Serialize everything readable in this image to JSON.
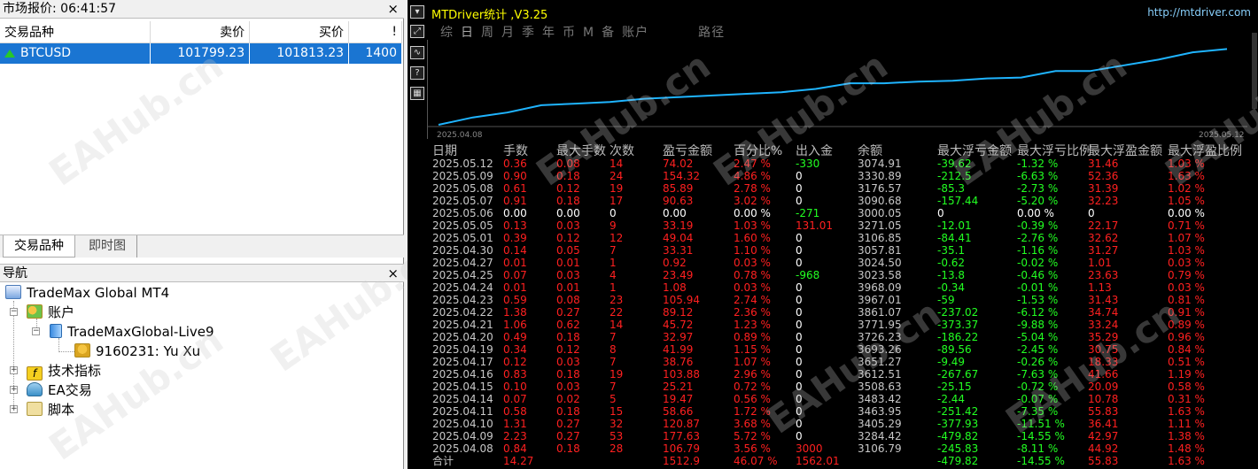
{
  "market_watch": {
    "title": "市场报价: 06:41:57",
    "close_label": "×",
    "columns": [
      "交易品种",
      "卖价",
      "买价",
      "!"
    ],
    "rows": [
      {
        "symbol": "BTCUSD",
        "bid": "101799.23",
        "ask": "101813.23",
        "spread": "1400"
      }
    ],
    "tabs": [
      "交易品种",
      "即时图"
    ]
  },
  "navigator": {
    "title": "导航",
    "close_label": "×",
    "root": "TradeMax Global MT4",
    "accounts": "账户",
    "server": "TradeMaxGlobal-Live9",
    "account": "9160231: Yu Xu",
    "indicators": "技术指标",
    "experts": "EA交易",
    "scripts": "脚本"
  },
  "chart": {
    "indicator_title": "MTDriver统计 ,V3.25",
    "url": "http://mtdriver.com",
    "menu": [
      "综",
      "日",
      "周",
      "月",
      "季",
      "年",
      "币",
      "M",
      "备",
      "账户",
      "",
      "路径"
    ],
    "menu_selected_index": 1,
    "equity_curve": {
      "x_start_label": "2025.04.08",
      "x_end_label": "2025.05.12",
      "values": [
        3106.79,
        3284.42,
        3405.29,
        3463.95,
        3483.42,
        3508.63,
        3612.51,
        3651.27,
        3693.26,
        3726.23,
        3771.95,
        3861.07,
        3967.01,
        3968.09,
        3023.58,
        3024.5,
        3057.81,
        3106.85,
        3271.05,
        3000.05,
        3090.68,
        3176.57,
        3330.89,
        3074.91
      ],
      "display_values": [
        0.0,
        0.09,
        0.15,
        0.24,
        0.26,
        0.28,
        0.32,
        0.34,
        0.36,
        0.38,
        0.4,
        0.44,
        0.51,
        0.51,
        0.53,
        0.54,
        0.57,
        0.58,
        0.66,
        0.66,
        0.73,
        0.8,
        0.89,
        0.93
      ],
      "color": "#1fb4ff"
    },
    "headers": [
      "日期",
      "手数",
      "最大手数",
      "次数",
      "盈亏金额",
      "百分比%",
      "出入金",
      "余额",
      "最大浮亏金额",
      "最大浮亏比例",
      "最大浮盈金额",
      "最大浮盈比例"
    ],
    "rows": [
      [
        "2025.05.12",
        "0.36",
        "0.08",
        "14",
        "74.02",
        "2.47 %",
        "-330",
        "3074.91",
        "-39.62",
        "-1.32 %",
        "31.46",
        "1.03 %"
      ],
      [
        "2025.05.09",
        "0.90",
        "0.18",
        "24",
        "154.32",
        "4.86 %",
        "0",
        "3330.89",
        "-212.5",
        "-6.63 %",
        "52.36",
        "1.63 %"
      ],
      [
        "2025.05.08",
        "0.61",
        "0.12",
        "19",
        "85.89",
        "2.78 %",
        "0",
        "3176.57",
        "-85.3",
        "-2.73 %",
        "31.39",
        "1.02 %"
      ],
      [
        "2025.05.07",
        "0.91",
        "0.18",
        "17",
        "90.63",
        "3.02 %",
        "0",
        "3090.68",
        "-157.44",
        "-5.20 %",
        "32.23",
        "1.05 %"
      ],
      [
        "2025.05.06",
        "0.00",
        "0.00",
        "0",
        "0.00",
        "0.00 %",
        "-271",
        "3000.05",
        "0",
        "0.00 %",
        "0",
        "0.00 %"
      ],
      [
        "2025.05.05",
        "0.13",
        "0.03",
        "9",
        "33.19",
        "1.03 %",
        "131.01",
        "3271.05",
        "-12.01",
        "-0.39 %",
        "22.17",
        "0.71 %"
      ],
      [
        "2025.05.01",
        "0.39",
        "0.12",
        "12",
        "49.04",
        "1.60 %",
        "0",
        "3106.85",
        "-84.41",
        "-2.76 %",
        "32.62",
        "1.07 %"
      ],
      [
        "2025.04.30",
        "0.14",
        "0.05",
        "7",
        "33.31",
        "1.10 %",
        "0",
        "3057.81",
        "-35.1",
        "-1.16 %",
        "31.27",
        "1.03 %"
      ],
      [
        "2025.04.27",
        "0.01",
        "0.01",
        "1",
        "0.92",
        "0.03 %",
        "0",
        "3024.50",
        "-0.62",
        "-0.02 %",
        "1.01",
        "0.03 %"
      ],
      [
        "2025.04.25",
        "0.07",
        "0.03",
        "4",
        "23.49",
        "0.78 %",
        "-968",
        "3023.58",
        "-13.8",
        "-0.46 %",
        "23.63",
        "0.79 %"
      ],
      [
        "2025.04.24",
        "0.01",
        "0.01",
        "1",
        "1.08",
        "0.03 %",
        "0",
        "3968.09",
        "-0.34",
        "-0.01 %",
        "1.13",
        "0.03 %"
      ],
      [
        "2025.04.23",
        "0.59",
        "0.08",
        "23",
        "105.94",
        "2.74 %",
        "0",
        "3967.01",
        "-59",
        "-1.53 %",
        "31.43",
        "0.81 %"
      ],
      [
        "2025.04.22",
        "1.38",
        "0.27",
        "22",
        "89.12",
        "2.36 %",
        "0",
        "3861.07",
        "-237.02",
        "-6.12 %",
        "34.74",
        "0.91 %"
      ],
      [
        "2025.04.21",
        "1.06",
        "0.62",
        "14",
        "45.72",
        "1.23 %",
        "0",
        "3771.95",
        "-373.37",
        "-9.88 %",
        "33.24",
        "0.89 %"
      ],
      [
        "2025.04.20",
        "0.49",
        "0.18",
        "7",
        "32.97",
        "0.89 %",
        "0",
        "3726.23",
        "-186.22",
        "-5.04 %",
        "35.29",
        "0.96 %"
      ],
      [
        "2025.04.19",
        "0.34",
        "0.12",
        "8",
        "41.99",
        "1.15 %",
        "0",
        "3693.26",
        "-89.56",
        "-2.45 %",
        "30.75",
        "0.84 %"
      ],
      [
        "2025.04.17",
        "0.12",
        "0.03",
        "7",
        "38.76",
        "1.07 %",
        "0",
        "3651.27",
        "-9.49",
        "-0.26 %",
        "18.33",
        "0.51 %"
      ],
      [
        "2025.04.16",
        "0.83",
        "0.18",
        "19",
        "103.88",
        "2.96 %",
        "0",
        "3612.51",
        "-267.67",
        "-7.63 %",
        "41.66",
        "1.19 %"
      ],
      [
        "2025.04.15",
        "0.10",
        "0.03",
        "7",
        "25.21",
        "0.72 %",
        "0",
        "3508.63",
        "-25.15",
        "-0.72 %",
        "20.09",
        "0.58 %"
      ],
      [
        "2025.04.14",
        "0.07",
        "0.02",
        "5",
        "19.47",
        "0.56 %",
        "0",
        "3483.42",
        "-2.44",
        "-0.07 %",
        "10.78",
        "0.31 %"
      ],
      [
        "2025.04.11",
        "0.58",
        "0.18",
        "15",
        "58.66",
        "1.72 %",
        "0",
        "3463.95",
        "-251.42",
        "-7.35 %",
        "55.83",
        "1.63 %"
      ],
      [
        "2025.04.10",
        "1.31",
        "0.27",
        "32",
        "120.87",
        "3.68 %",
        "0",
        "3405.29",
        "-377.93",
        "-11.51 %",
        "36.41",
        "1.11 %"
      ],
      [
        "2025.04.09",
        "2.23",
        "0.27",
        "53",
        "177.63",
        "5.72 %",
        "0",
        "3284.42",
        "-479.82",
        "-14.55 %",
        "42.97",
        "1.38 %"
      ],
      [
        "2025.04.08",
        "0.84",
        "0.18",
        "28",
        "106.79",
        "3.56 %",
        "3000",
        "3106.79",
        "-245.83",
        "-8.11 %",
        "44.92",
        "1.48 %"
      ]
    ],
    "total_row": [
      "合计",
      "14.27",
      "",
      "",
      "1512.9",
      "46.07 %",
      "1562.01",
      "",
      "-479.82",
      "-14.55 %",
      "55.83",
      "1.63 %"
    ]
  },
  "watermark": "EAHub.cn",
  "colors": {
    "selection": "#1a75d2",
    "loss": "#ff2020",
    "profit": "#22ff22",
    "title": "#ffff00",
    "link": "#87cefa"
  }
}
